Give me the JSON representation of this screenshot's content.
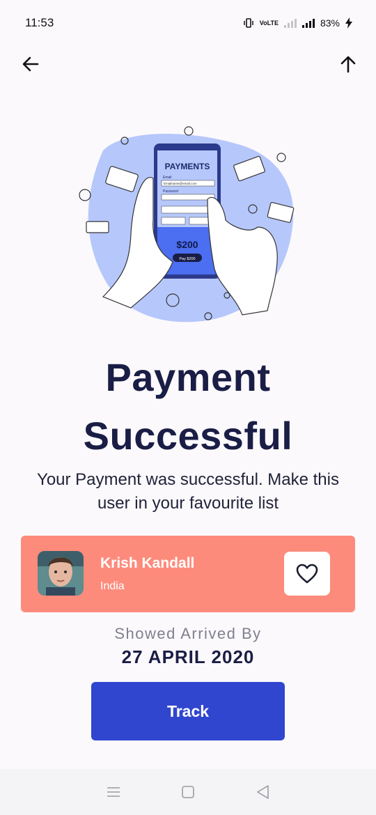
{
  "status_bar": {
    "time": "11:53",
    "network_label": "VoLTE",
    "battery": "83%"
  },
  "nav": {
    "back_icon": "arrow-left-icon",
    "share_icon": "arrow-up-icon"
  },
  "hero": {
    "screen_title": "PAYMENTS",
    "email_label": "Email",
    "email_value": "Emailname@email.com",
    "password_label": "Password",
    "amount": "$200",
    "pay_button": "Pay $200"
  },
  "title": {
    "line1": "Payment",
    "line2": "Successful"
  },
  "subtitle": "Your Payment was successful. Make this user in your favourite list",
  "user": {
    "name": "Krish Kandall",
    "country": "India",
    "favorite_icon": "heart-icon"
  },
  "arrival": {
    "label": "Showed Arrived By",
    "date": "27 APRIL 2020"
  },
  "track_button": "Track",
  "colors": {
    "card": "#fd8b7c",
    "button": "#3046cf",
    "title": "#1a1d45",
    "hero_blob": "#b6c7fb"
  }
}
